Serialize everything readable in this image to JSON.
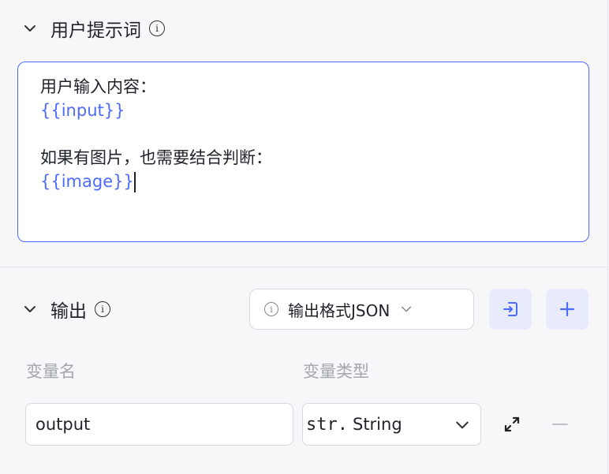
{
  "prompt_section": {
    "title": "用户提示词",
    "lines": [
      {
        "text": "用户输入内容："
      },
      {
        "var": "{{input}}"
      },
      {
        "text": ""
      },
      {
        "text": "如果有图片，也需要结合判断："
      },
      {
        "var": "{{image}}"
      }
    ]
  },
  "output_section": {
    "title": "输出",
    "format_button": "输出格式JSON",
    "columns": {
      "name": "变量名",
      "type": "变量类型"
    },
    "row": {
      "name_value": "output",
      "type_prefix": "str.",
      "type_value": "String"
    }
  },
  "icons": {
    "collapse": "chevron-down-icon",
    "info": "info-circle-icon",
    "import": "import-icon",
    "add": "plus-icon",
    "expand": "expand-arrows-icon",
    "remove": "minus-icon"
  },
  "colors": {
    "accent": "#4d6bfe",
    "muted": "#a3a6ad",
    "button_bg": "#e8ebfb"
  }
}
